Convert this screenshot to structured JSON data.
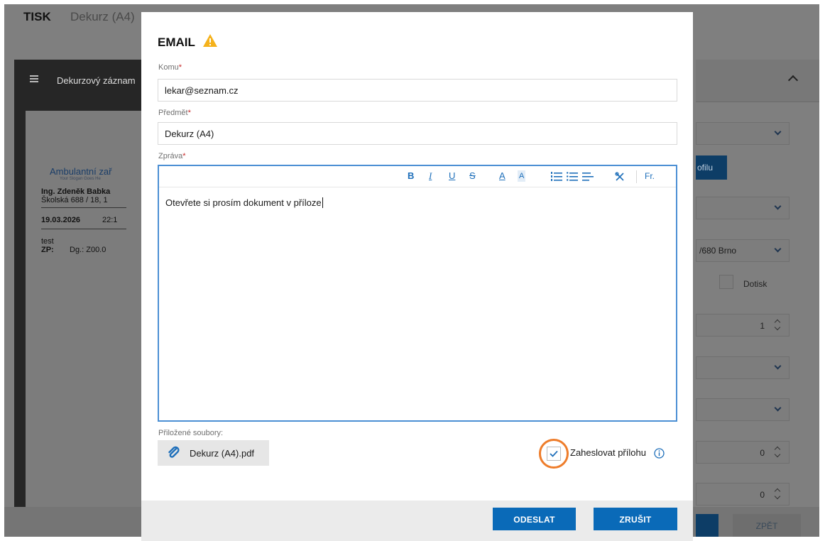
{
  "background": {
    "app_title": "TISK",
    "tab": "Dekurz (A4)",
    "doc_panel_title": "Dekurzový záznam",
    "doc_preview": {
      "brand": "Ambulantní zař",
      "slogan": "Your Slogan Goes He",
      "doctor": "Ing. Zdeněk Babka",
      "address": "Školská 688 / 18, 1",
      "date": "19.03.2026",
      "time": "22:1",
      "note": "test",
      "zp_label": "ZP:",
      "dg": "Dg.: Z00.0"
    },
    "right_panel": {
      "profile_button_fragment": "ofilu",
      "address_fragment": "/680 Brno",
      "dotisk_label": "Dotisk",
      "copies": "1",
      "spin_a": "0",
      "spin_b": "0",
      "back_button": "ZPĚT"
    }
  },
  "email_dialog": {
    "title": "EMAIL",
    "to": {
      "label": "Komu",
      "required_mark": "*",
      "value": "lekar@seznam.cz"
    },
    "subject": {
      "label": "Předmět",
      "required_mark": "*",
      "value": "Dekurz (A4)"
    },
    "message": {
      "label": "Zpráva",
      "required_mark": "*",
      "body": "Otevřete si prosím dokument v příloze",
      "toolbar": {
        "bold": "B",
        "italic": "I",
        "underline": "U",
        "strike": "S",
        "font_color": "A",
        "highlight": "A",
        "font_size": "Fr."
      }
    },
    "attachments": {
      "label": "Přiložené soubory:",
      "file": "Dekurz (A4).pdf"
    },
    "encrypt_attachment": {
      "label": "Zaheslovat přílohu",
      "checked": true
    },
    "buttons": {
      "send": "ODESLAT",
      "cancel": "ZRUŠIT"
    }
  },
  "colors": {
    "accent": "#0a6ab8",
    "warning": "#f5b21c",
    "highlight_ring": "#ee7d2b",
    "editor_focus": "#4b8fd4"
  }
}
